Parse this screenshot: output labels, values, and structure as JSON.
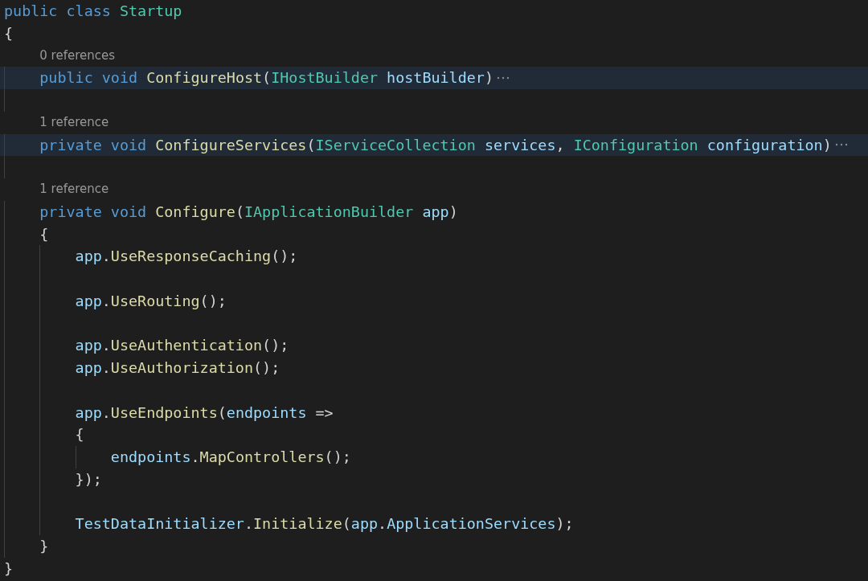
{
  "editor": {
    "lines": [
      {
        "kind": "code",
        "collapsed": false,
        "tokens": [
          {
            "kind": "keyword",
            "text": "public class "
          },
          {
            "kind": "type",
            "text": "Startup"
          }
        ]
      },
      {
        "kind": "code",
        "collapsed": false,
        "tokens": [
          {
            "kind": "punct",
            "text": "{"
          }
        ],
        "children": [
          {
            "kind": "codelens",
            "text": "0 references"
          },
          {
            "kind": "code",
            "collapsed": true,
            "tokens": [
              {
                "kind": "keyword",
                "text": "public void "
              },
              {
                "kind": "method",
                "text": "ConfigureHost"
              },
              {
                "kind": "punct",
                "text": "("
              },
              {
                "kind": "type",
                "text": "IHostBuilder"
              },
              {
                "kind": "param",
                "text": " hostBuilder"
              },
              {
                "kind": "punct",
                "text": ")"
              }
            ]
          },
          {
            "kind": "blank"
          },
          {
            "kind": "codelens",
            "text": "1 reference"
          },
          {
            "kind": "code",
            "collapsed": true,
            "tokens": [
              {
                "kind": "keyword",
                "text": "private void "
              },
              {
                "kind": "method",
                "text": "ConfigureServices"
              },
              {
                "kind": "punct",
                "text": "("
              },
              {
                "kind": "type",
                "text": "IServiceCollection"
              },
              {
                "kind": "param",
                "text": " services"
              },
              {
                "kind": "punct",
                "text": ", "
              },
              {
                "kind": "type",
                "text": "IConfiguration"
              },
              {
                "kind": "param",
                "text": " configuration"
              },
              {
                "kind": "punct",
                "text": ")"
              }
            ]
          },
          {
            "kind": "blank"
          },
          {
            "kind": "codelens",
            "text": "1 reference"
          },
          {
            "kind": "code",
            "collapsed": false,
            "tokens": [
              {
                "kind": "keyword",
                "text": "private void "
              },
              {
                "kind": "method",
                "text": "Configure"
              },
              {
                "kind": "punct",
                "text": "("
              },
              {
                "kind": "type",
                "text": "IApplicationBuilder"
              },
              {
                "kind": "param",
                "text": " app"
              },
              {
                "kind": "punct",
                "text": ")"
              }
            ]
          },
          {
            "kind": "code",
            "collapsed": false,
            "tokens": [
              {
                "kind": "punct",
                "text": "{"
              }
            ],
            "children": [
              {
                "kind": "code",
                "collapsed": false,
                "tokens": [
                  {
                    "kind": "param",
                    "text": "app"
                  },
                  {
                    "kind": "punct",
                    "text": "."
                  },
                  {
                    "kind": "method",
                    "text": "UseResponseCaching"
                  },
                  {
                    "kind": "punct",
                    "text": "();"
                  }
                ]
              },
              {
                "kind": "blank"
              },
              {
                "kind": "code",
                "collapsed": false,
                "tokens": [
                  {
                    "kind": "param",
                    "text": "app"
                  },
                  {
                    "kind": "punct",
                    "text": "."
                  },
                  {
                    "kind": "method",
                    "text": "UseRouting"
                  },
                  {
                    "kind": "punct",
                    "text": "();"
                  }
                ]
              },
              {
                "kind": "blank"
              },
              {
                "kind": "code",
                "collapsed": false,
                "tokens": [
                  {
                    "kind": "param",
                    "text": "app"
                  },
                  {
                    "kind": "punct",
                    "text": "."
                  },
                  {
                    "kind": "method",
                    "text": "UseAuthentication"
                  },
                  {
                    "kind": "punct",
                    "text": "();"
                  }
                ]
              },
              {
                "kind": "code",
                "collapsed": false,
                "tokens": [
                  {
                    "kind": "param",
                    "text": "app"
                  },
                  {
                    "kind": "punct",
                    "text": "."
                  },
                  {
                    "kind": "method",
                    "text": "UseAuthorization"
                  },
                  {
                    "kind": "punct",
                    "text": "();"
                  }
                ]
              },
              {
                "kind": "blank"
              },
              {
                "kind": "code",
                "collapsed": false,
                "tokens": [
                  {
                    "kind": "param",
                    "text": "app"
                  },
                  {
                    "kind": "punct",
                    "text": "."
                  },
                  {
                    "kind": "method",
                    "text": "UseEndpoints"
                  },
                  {
                    "kind": "punct",
                    "text": "("
                  },
                  {
                    "kind": "param",
                    "text": "endpoints"
                  },
                  {
                    "kind": "punct",
                    "text": " =>"
                  }
                ]
              },
              {
                "kind": "code",
                "collapsed": false,
                "tokens": [
                  {
                    "kind": "punct",
                    "text": "{"
                  }
                ],
                "children": [
                  {
                    "kind": "code",
                    "collapsed": false,
                    "tokens": [
                      {
                        "kind": "param",
                        "text": "endpoints"
                      },
                      {
                        "kind": "punct",
                        "text": "."
                      },
                      {
                        "kind": "method",
                        "text": "MapControllers"
                      },
                      {
                        "kind": "punct",
                        "text": "();"
                      }
                    ]
                  }
                ]
              },
              {
                "kind": "code",
                "collapsed": false,
                "tokens": [
                  {
                    "kind": "punct",
                    "text": "});"
                  }
                ]
              },
              {
                "kind": "blank"
              },
              {
                "kind": "code",
                "collapsed": false,
                "tokens": [
                  {
                    "kind": "param",
                    "text": "TestDataInitializer"
                  },
                  {
                    "kind": "punct",
                    "text": "."
                  },
                  {
                    "kind": "method",
                    "text": "Initialize"
                  },
                  {
                    "kind": "punct",
                    "text": "("
                  },
                  {
                    "kind": "param",
                    "text": "app"
                  },
                  {
                    "kind": "punct",
                    "text": "."
                  },
                  {
                    "kind": "param",
                    "text": "ApplicationServices"
                  },
                  {
                    "kind": "punct",
                    "text": ");"
                  }
                ]
              }
            ]
          },
          {
            "kind": "code",
            "collapsed": false,
            "tokens": [
              {
                "kind": "punct",
                "text": "}"
              }
            ]
          }
        ]
      },
      {
        "kind": "code",
        "collapsed": false,
        "tokens": [
          {
            "kind": "punct",
            "text": "}"
          }
        ]
      }
    ]
  }
}
